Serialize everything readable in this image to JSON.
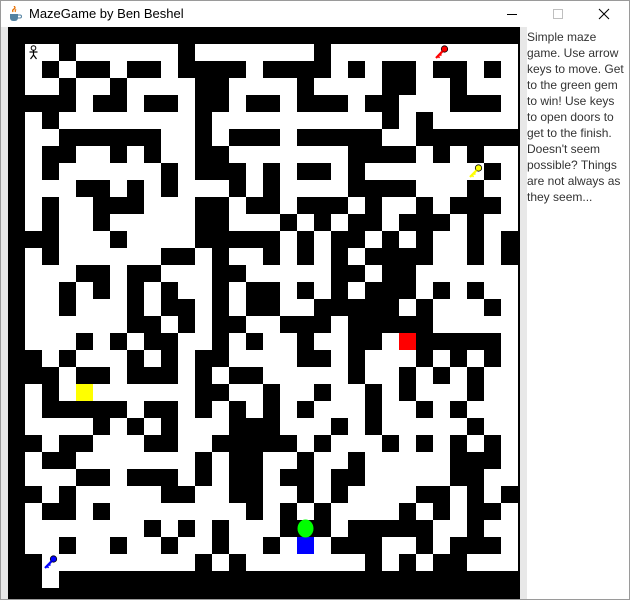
{
  "window": {
    "title": "MazeGame by Ben Beshel",
    "minimize_icon": "minimize-icon",
    "maximize_icon": "maximize-icon",
    "close_icon": "close-icon"
  },
  "info_text": "Simple maze game. Use arrow keys to move. Get to the green gem to win! Use keys to open doors to get to the finish. Doesn't seem possible? Things are not always as they seem...",
  "maze": {
    "rows": [
      "1111111111111111111111111111111",
      "1P0100000010000000100000K000001",
      "1010110110111101111010110110101",
      "1001001000011000010000110010001",
      "1111011011011011011101100011101",
      "1010000000010000000000101000001",
      "1001111110010111011111001111111",
      "1011001010011000000011110101K01",
      "1010000001011101011010000001101",
      "1000110101000101000011110001001",
      "1010011100011011011101001011101",
      "1010010000011000101011011101001",
      "1110001000011111010110101001011",
      "1010000001101001010101111001011",
      "1000110110001100000110110000001",
      "1001010101001011010101110101001",
      "1001000101101011001111101000101",
      "1000000110101100111011111000001",
      "1000101011001010010011001111101",
      "1101000101011000011010001010101",
      "1110110111010110000010010101001",
      "1010100000011001001001010001001",
      "1011111011010101010001001010001",
      "1000010101000111000101000001001",
      "1101100011001111101000101010101",
      "1011000000010110010010000011101",
      "1000110111010110110110000011001",
      "1101000001100110010100001101011",
      "1011010000000010101000010101101",
      "1000000010101000111011111001001",
      "1001001001001001000111001011101",
      "1100000000010100000001010110001",
      "1101111111111111111111111111111"
    ],
    "doors": [
      {
        "color": "#ff0000",
        "row": 18,
        "col": 23
      },
      {
        "color": "#ffff00",
        "row": 21,
        "col": 4
      },
      {
        "color": "#0000ff",
        "row": 30,
        "col": 17
      }
    ],
    "gem": {
      "color": "#00ff00",
      "row": 29,
      "col": 17
    },
    "player": {
      "row": 1,
      "col": 1,
      "icon": "player-icon"
    },
    "keys": [
      {
        "color": "#ff0000",
        "row": 1,
        "col": 25,
        "icon": "red-key-icon"
      },
      {
        "color": "#ffff00",
        "row": 8,
        "col": 27,
        "icon": "yellow-key-icon"
      },
      {
        "color": "#0000ff",
        "row": 31,
        "col": 2,
        "icon": "blue-key-icon"
      }
    ]
  }
}
